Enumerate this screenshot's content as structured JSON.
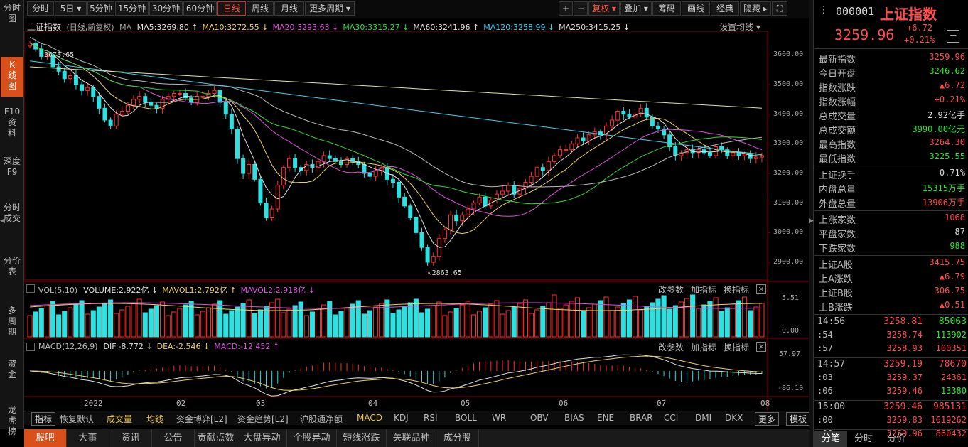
{
  "left_nav": [
    {
      "label": "分时\n图",
      "active": false
    },
    {
      "label": "K\n线\n图",
      "active": true
    },
    {
      "label": "F10\n资\n料",
      "active": false
    },
    {
      "label": "深度\nF9",
      "active": false
    },
    {
      "label": "分时\n成交",
      "active": false
    },
    {
      "label": "分价\n表",
      "active": false
    },
    {
      "label": "多\n周\n期",
      "active": false
    },
    {
      "label": "资\n金",
      "active": false
    },
    {
      "label": "龙\n虎\n榜",
      "active": false
    }
  ],
  "toolbar": {
    "periods": [
      "分时",
      "5日 ▾",
      "5分钟",
      "15分钟",
      "30分钟",
      "60分钟",
      "日线",
      "周线",
      "月线",
      "更多周期 ▾"
    ],
    "active_period": "日线",
    "right": [
      "+",
      "−",
      "复权 ▾",
      "叠加 ▾",
      "筹码",
      "画线",
      "经典",
      "隐藏 ▸",
      "⛶"
    ]
  },
  "main_legend": {
    "title": "上证指数",
    "mode": "(日线,前复权)",
    "ma_prefix": "MA",
    "ma": [
      {
        "label": "MA5:3269.80",
        "arrow": "↑",
        "color": "#e0e0e0"
      },
      {
        "label": "MA10:3272.55",
        "arrow": "↓",
        "color": "#f0d060"
      },
      {
        "label": "MA20:3293.63",
        "arrow": "↓",
        "color": "#e050e0"
      },
      {
        "label": "MA30:3315.27",
        "arrow": "↓",
        "color": "#33dd33"
      },
      {
        "label": "MA60:3241.96",
        "arrow": "↑",
        "color": "#e0e0e0"
      },
      {
        "label": "MA120:3258.99",
        "arrow": "↓",
        "color": "#40d0f0"
      },
      {
        "label": "MA250:3415.25",
        "arrow": "↓",
        "color": "#e0e0e0"
      }
    ],
    "settings": "设置均线 ▾"
  },
  "price_axis": [
    "3600.00",
    "3500.00",
    "3400.00",
    "3300.00",
    "3200.00",
    "3100.00",
    "3000.00",
    "2900.00"
  ],
  "annotations": {
    "high": "3673.65",
    "low": "2863.65"
  },
  "volume": {
    "title": "VOL(5,10)",
    "items": [
      {
        "label": "VOLUME:2.922亿",
        "arrow": "↓",
        "color": "#e0e0e0"
      },
      {
        "label": "MAVOL1:2.792亿",
        "arrow": "↑",
        "color": "#f0d060"
      },
      {
        "label": "MAVOL2:2.918亿",
        "arrow": "↓",
        "color": "#e050e0"
      }
    ],
    "axis": [
      "5.51",
      "0.00"
    ],
    "buttons": [
      "改参数",
      "加指标",
      "换指标"
    ]
  },
  "macd": {
    "title": "MACD(12,26,9)",
    "items": [
      {
        "label": "DIF:-8.772",
        "arrow": "↓",
        "color": "#e0e0e0"
      },
      {
        "label": "DEA:-2.546",
        "arrow": "↓",
        "color": "#f0d060"
      },
      {
        "label": "MACD:-12.452",
        "arrow": "↑",
        "color": "#e050e0"
      }
    ],
    "axis": [
      "57.97",
      "-86.10"
    ],
    "buttons": [
      "改参数",
      "加指标",
      "换指标"
    ]
  },
  "date_axis": [
    "2022",
    "02",
    "03",
    "04",
    "05",
    "06",
    "07",
    "08"
  ],
  "indicator_tabs": [
    "指标",
    "恢复默认",
    "成交量",
    "均线",
    "资金博弈[L2]",
    "资金趋势[L2]",
    "沪股通净额",
    "MACD",
    "KDJ",
    "RSI",
    "BOLL",
    "WR",
    "OBV",
    "BIAS",
    "ENE",
    "BRAR",
    "CCI",
    "DMI",
    "DKX",
    "更多",
    "模板"
  ],
  "bottom_tabs": [
    "股吧",
    "大事",
    "资讯",
    "公告",
    "贡献点数",
    "大盘异动",
    "个股异动",
    "短线涨跌",
    "关联品种",
    "成分股"
  ],
  "quote": {
    "code": "000001",
    "name": "上证指数",
    "price": "3259.96",
    "change": "+6.72",
    "pct": "+0.21%",
    "rows": [
      {
        "k": "最新指数",
        "v": "3259.96",
        "c": "r"
      },
      {
        "k": "今日开盘",
        "v": "3246.62",
        "c": "g"
      },
      {
        "k": "指数涨跌",
        "v": "▲6.72",
        "c": "r"
      },
      {
        "k": "指数涨幅",
        "v": "+0.21%",
        "c": "r"
      },
      {
        "k": "总成交量",
        "v": "2.92亿手",
        "c": "w"
      },
      {
        "k": "总成交额",
        "v": "3990.00亿元",
        "c": "g"
      },
      {
        "k": "最高指数",
        "v": "3264.30",
        "c": "r"
      },
      {
        "k": "最低指数",
        "v": "3225.55",
        "c": "g"
      }
    ],
    "rows2": [
      {
        "k": "上证换手",
        "v": "0.71%",
        "c": "w"
      },
      {
        "k": "内盘总量",
        "v": "15315万手",
        "c": "g"
      },
      {
        "k": "外盘总量",
        "v": "13906万手",
        "c": "r"
      }
    ],
    "rows3": [
      {
        "k": "上涨家数",
        "v": "1068",
        "c": "r"
      },
      {
        "k": "平盘家数",
        "v": "87",
        "c": "w"
      },
      {
        "k": "下跌家数",
        "v": "988",
        "c": "g"
      }
    ],
    "rows4": [
      {
        "k": "上证A股",
        "v": "3415.75",
        "c": "r"
      },
      {
        "k": "上A涨跌",
        "v": "▲6.79",
        "c": "r"
      },
      {
        "k": "上证B股",
        "v": "306.75",
        "c": "r"
      },
      {
        "k": "上B涨跌",
        "v": "▲0.51",
        "c": "r"
      }
    ],
    "ticks": [
      {
        "t": "14:56",
        "p": "3258.81",
        "v": "85063",
        "c": "r",
        "vc": "g"
      },
      {
        "t": ":54",
        "p": "3258.74",
        "v": "113902",
        "c": "r",
        "vc": "g"
      },
      {
        "t": ":57",
        "p": "3258.93",
        "v": "100351",
        "c": "r",
        "vc": "r"
      },
      {
        "t": "14:57",
        "p": "3259.19",
        "v": "78670",
        "c": "r",
        "vc": "r"
      },
      {
        "t": ":03",
        "p": "3259.37",
        "v": "24361",
        "c": "r",
        "vc": "r"
      },
      {
        "t": ":06",
        "p": "3259.46",
        "v": "13380",
        "c": "r",
        "vc": "g"
      },
      {
        "t": "15:00",
        "p": "3259.46",
        "v": "985131",
        "c": "r",
        "vc": "r"
      },
      {
        "t": ":00",
        "p": "3259.83",
        "v": "1619262",
        "c": "r",
        "vc": "r"
      },
      {
        "t": ":00",
        "p": "3259.96",
        "v": "860432",
        "c": "r",
        "vc": "r"
      }
    ],
    "tabs": [
      "分笔",
      "分时",
      "分价"
    ]
  },
  "chart_data": {
    "type": "candlestick",
    "instrument": "上证指数",
    "yrange": [
      2840,
      3680
    ],
    "series_close": [
      3640,
      3620,
      3595,
      3600,
      3560,
      3545,
      3520,
      3530,
      3500,
      3480,
      3490,
      3460,
      3420,
      3380,
      3360,
      3400,
      3410,
      3430,
      3450,
      3460,
      3440,
      3430,
      3420,
      3450,
      3460,
      3470,
      3470,
      3455,
      3440,
      3460,
      3460,
      3470,
      3480,
      3440,
      3400,
      3350,
      3250,
      3200,
      3230,
      3180,
      3100,
      3050,
      3080,
      3160,
      3220,
      3250,
      3220,
      3210,
      3230,
      3220,
      3240,
      3260,
      3250,
      3240,
      3230,
      3250,
      3240,
      3230,
      3200,
      3190,
      3210,
      3220,
      3180,
      3170,
      3120,
      3090,
      3050,
      3000,
      2950,
      2900,
      2920,
      2980,
      3010,
      3060,
      3040,
      3060,
      3080,
      3100,
      3120,
      3090,
      3110,
      3130,
      3140,
      3160,
      3130,
      3150,
      3170,
      3190,
      3220,
      3210,
      3240,
      3260,
      3280,
      3280,
      3300,
      3320,
      3310,
      3330,
      3340,
      3330,
      3360,
      3380,
      3410,
      3400,
      3390,
      3400,
      3420,
      3390,
      3360,
      3350,
      3330,
      3290,
      3260,
      3270,
      3280,
      3270,
      3280,
      3270,
      3260,
      3290,
      3280,
      3260,
      3270,
      3260,
      3265,
      3250,
      3255,
      3260
    ]
  }
}
